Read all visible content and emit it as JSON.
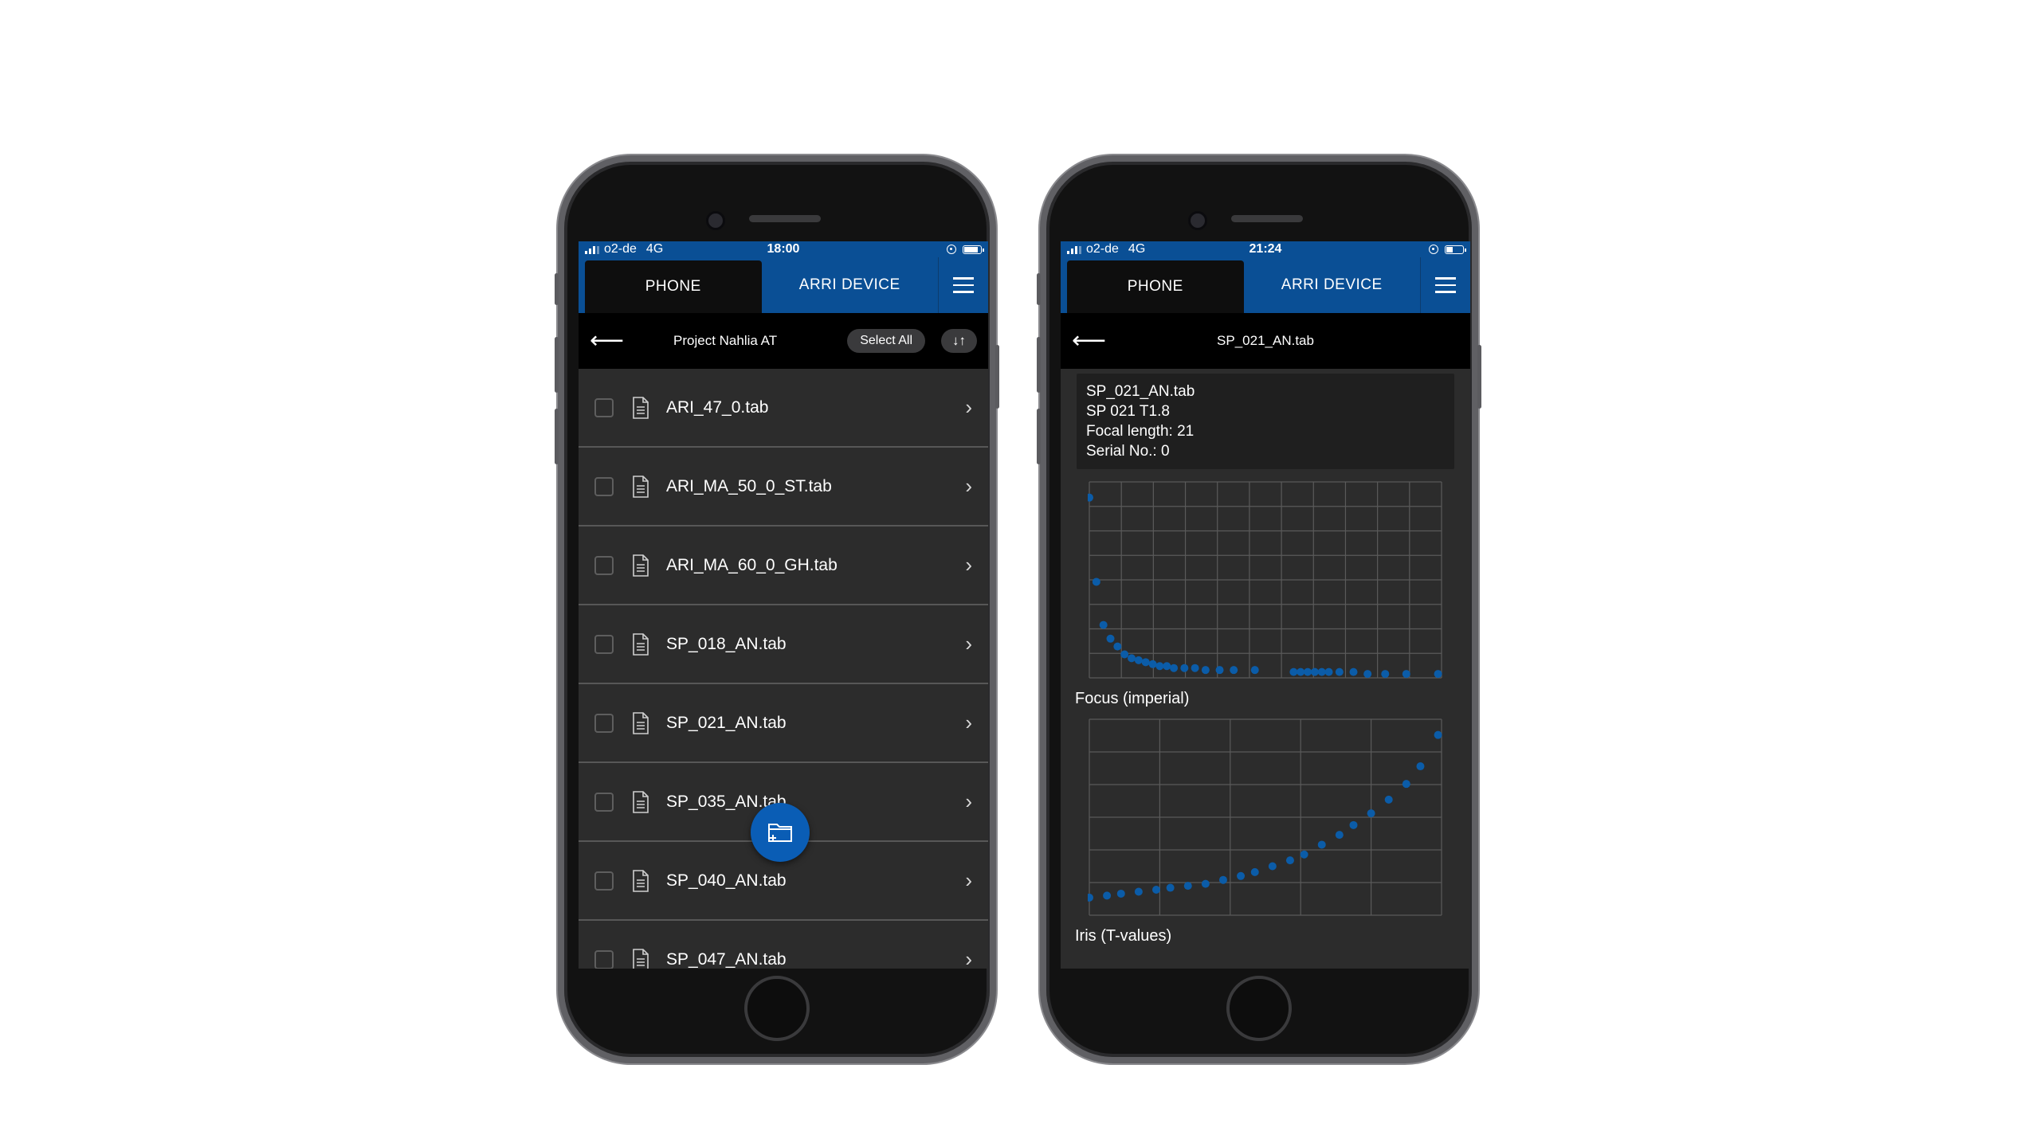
{
  "left_phone": {
    "status": {
      "carrier": "o2-de",
      "network": "4G",
      "time": "18:00"
    },
    "tabs": {
      "phone": "PHONE",
      "device": "ARRI DEVICE"
    },
    "nav": {
      "back_icon": "arrow-left-icon",
      "title": "Project Nahlia AT",
      "select_all": "Select All",
      "sort_label": "↓↑"
    },
    "files": [
      {
        "name": "ARI_47_0.tab"
      },
      {
        "name": "ARI_MA_50_0_ST.tab"
      },
      {
        "name": "ARI_MA_60_0_GH.tab"
      },
      {
        "name": "SP_018_AN.tab"
      },
      {
        "name": "SP_021_AN.tab"
      },
      {
        "name": "SP_035_AN.tab"
      },
      {
        "name": "SP_040_AN.tab"
      },
      {
        "name": "SP_047_AN.tab"
      }
    ],
    "fab_icon": "add-folder-icon"
  },
  "right_phone": {
    "status": {
      "carrier": "o2-de",
      "network": "4G",
      "time": "21:24"
    },
    "tabs": {
      "phone": "PHONE",
      "device": "ARRI DEVICE"
    },
    "nav": {
      "back_icon": "arrow-left-icon",
      "title": "SP_021_AN.tab"
    },
    "info": {
      "line1": "SP_021_AN.tab",
      "line2": "SP 021 T1.8",
      "line3": "Focal length: 21",
      "line4": "Serial No.: 0"
    },
    "charts": {
      "focus_label": "Focus (imperial)",
      "iris_label": "Iris (T-values)"
    }
  },
  "colors": {
    "brand_blue": "#0a4f95",
    "dot_blue": "#0b5ca8",
    "row_bg": "#2c2c2c"
  },
  "chart_data": [
    {
      "type": "scatter",
      "title": "",
      "xlabel": "Focus (imperial)",
      "ylabel": "",
      "xlim": [
        0,
        100
      ],
      "ylim": [
        0,
        100
      ],
      "grid": true,
      "series": [
        {
          "x": [
            0,
            2,
            4,
            6,
            8,
            10,
            12,
            14,
            16,
            18,
            20,
            22,
            24,
            27,
            30,
            33,
            37,
            41,
            47,
            58,
            60,
            62,
            64,
            66,
            68,
            71,
            75,
            79,
            84,
            90,
            99
          ],
          "y": [
            92,
            49,
            27,
            20,
            16,
            12,
            10,
            9,
            8,
            7,
            6,
            6,
            5,
            5,
            5,
            4,
            4,
            4,
            4,
            3,
            3,
            3,
            3,
            3,
            3,
            3,
            3,
            2,
            2,
            2,
            2
          ]
        }
      ]
    },
    {
      "type": "scatter",
      "title": "",
      "xlabel": "Iris (T-values)",
      "ylabel": "",
      "xlim": [
        0,
        100
      ],
      "ylim": [
        0,
        100
      ],
      "grid": true,
      "series": [
        {
          "x": [
            0,
            5,
            9,
            14,
            19,
            23,
            28,
            33,
            38,
            43,
            47,
            52,
            57,
            61,
            66,
            71,
            75,
            80,
            85,
            90,
            94,
            99
          ],
          "y": [
            9,
            10,
            11,
            12,
            13,
            14,
            15,
            16,
            18,
            20,
            22,
            25,
            28,
            31,
            36,
            41,
            46,
            52,
            59,
            67,
            76,
            92
          ]
        }
      ]
    }
  ]
}
